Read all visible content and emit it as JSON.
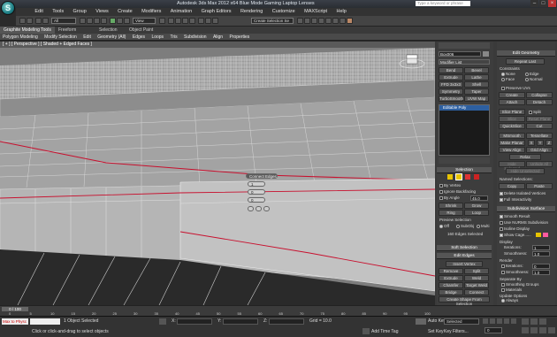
{
  "app": {
    "title": "Autodesk 3ds Max 2012 x64      Blue Mode Gaming Laptop Lenses",
    "search_placeholder": "Type a keyword or phrase",
    "logo_glyph": "S"
  },
  "menubar": [
    "Edit",
    "Tools",
    "Group",
    "Views",
    "Create",
    "Modifiers",
    "Animation",
    "Graph Editors",
    "Rendering",
    "Customize",
    "MAXScript",
    "Help"
  ],
  "toolbar": {
    "filter_select": "All",
    "view_select": "View",
    "selection_set": "Create Selection Se"
  },
  "ribbon": {
    "tabs": [
      "Graphite Modeling Tools",
      "Freeform",
      "Selection",
      "Object Paint"
    ],
    "items": [
      "Polygon Modeling",
      "Modify Selection",
      "Edit",
      "Geometry (All)",
      "Edges",
      "Loops",
      "Tris",
      "Subdivision",
      "Align",
      "Properties"
    ]
  },
  "viewport": {
    "label": "[ + ] [ Perspective ] [ Shaded + Edged Faces ]"
  },
  "caddy": {
    "title": "Connect Edges",
    "segments": "1",
    "pinch": "0",
    "slide": "0"
  },
  "modify_panel": {
    "object_name": "Box006",
    "modifier_list": "Modifier List",
    "mod_buttons": [
      "Bend",
      "Bevel",
      "Extrude",
      "Lathe",
      "FFD 3x3x3",
      "Shell",
      "Symmetry",
      "Taper",
      "TurboSmooth",
      "UVW Map"
    ],
    "stack_item": "Editable Poly",
    "selection": {
      "header": "Selection",
      "by_vertex": "By Vertex",
      "ignore_backfacing": "Ignore Backfacing",
      "by_angle": "By Angle",
      "angle_value": "45.0",
      "shrink": "Shrink",
      "grow": "Grow",
      "ring": "Ring",
      "loop": "Loop",
      "preview_label": "Preview Selection",
      "preview_opts": [
        "Off",
        "SubObj",
        "Multi"
      ],
      "status": "160 Edges Selected"
    },
    "soft_selection": "Soft Selection",
    "edit_edges": {
      "header": "Edit Edges",
      "insert_vertex": "Insert Vertex",
      "remove": "Remove",
      "split": "Split",
      "extrude": "Extrude",
      "weld": "Weld",
      "chamfer": "Chamfer",
      "target_weld": "Target Weld",
      "bridge": "Bridge",
      "connect": "Connect",
      "create_shape": "Create Shape From Selection",
      "weight_label": "Weight:",
      "weight_value": "1.0",
      "crease_label": "Crease:",
      "crease_value": "0.0"
    }
  },
  "edit_geometry": {
    "header": "Edit Geometry",
    "repeat_last": "Repeat Last",
    "constraints": "Constraints",
    "none": "None",
    "edge": "Edge",
    "face": "Face",
    "normal": "Normal",
    "preserve_uvs": "Preserve UVs",
    "create": "Create",
    "collapse": "Collapse",
    "attach": "Attach",
    "detach": "Detach",
    "slice_plane": "Slice Plane",
    "split": "Split",
    "slice": "Slice",
    "reset_plane": "Reset Plane",
    "quickslice": "QuickSlice",
    "cut": "Cut",
    "msmooth": "MSmooth",
    "tessellate": "Tessellate",
    "make_planar": "Make Planar",
    "xyz": [
      "X",
      "Y",
      "Z"
    ],
    "view_align": "View Align",
    "grid_align": "Grid Align",
    "relax": "Relax",
    "hide_selected": "Hide Selected",
    "unhide_all": "Unhide All",
    "hide_unselected": "Hide Unselected",
    "named_selections": "Named Selections:",
    "copy": "Copy",
    "paste": "Paste",
    "delete_isolated": "Delete Isolated Vertices",
    "full_interactivity": "Full Interactivity"
  },
  "subdivision_surface": {
    "header": "Subdivision Surface",
    "smooth_result": "Smooth Result",
    "use_nurms": "Use NURMS Subdivision",
    "isoline_display": "Isoline Display",
    "show_cage": "Show Cage......",
    "display": "Display",
    "iterations_label": "Iterations:",
    "iterations_value": "1",
    "smoothness_label": "Smoothness:",
    "smoothness_value": "1.0",
    "render": "Render",
    "r_iterations_value": "0",
    "r_smoothness_value": "1.0",
    "separate_by": "Separate By",
    "smoothing_groups": "Smoothing Groups",
    "materials": "Materials",
    "update_options": "Update Options",
    "always": "Always",
    "when_rendering": "When Rendering",
    "manually": "Manually"
  },
  "timeline": {
    "frame": "0 / 100",
    "ticks": [
      "0",
      "5",
      "10",
      "15",
      "20",
      "25",
      "30",
      "35",
      "40",
      "45",
      "50",
      "55",
      "60",
      "65",
      "70",
      "75",
      "80",
      "85",
      "90",
      "95",
      "100"
    ]
  },
  "status": {
    "objects": "1 Object Selected",
    "hint": "Click or click-and-drag to select objects",
    "maxscript": "Max to Physc",
    "x_label": "X:",
    "y_label": "Y:",
    "z_label": "Z:",
    "grid": "Grid = 10.0",
    "auto_key": "Auto Key",
    "set_key": "Set Key",
    "selected": "Selected",
    "key_filters": "Key Filters...",
    "add_time_tag": "Add Time Tag",
    "frame_value": "0"
  },
  "colors": {
    "accent": "#c8102e",
    "viewport_bg": "#7a7a7a",
    "ui_bg": "#3d3d3d"
  }
}
